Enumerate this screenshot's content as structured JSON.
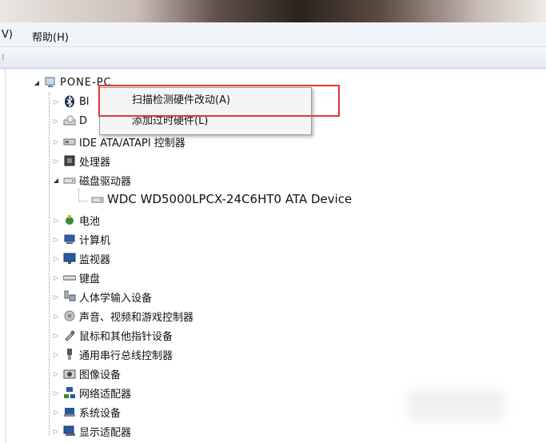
{
  "menubar": {
    "view_partial": "V)",
    "help": "帮助(H)"
  },
  "toolbar": {
    "partial_icon": "⁝"
  },
  "tree": {
    "root": "PONE-PC",
    "bluetooth_partial": "Bl",
    "disk_partial": "D",
    "items": [
      {
        "label": "IDE ATA/ATAPI 控制器"
      },
      {
        "label": "处理器"
      },
      {
        "label": "磁盘驱动器"
      },
      {
        "label": "WDC WD5000LPCX-24C6HT0 ATA Device"
      },
      {
        "label": "电池"
      },
      {
        "label": "计算机"
      },
      {
        "label": "监视器"
      },
      {
        "label": "键盘"
      },
      {
        "label": "人体学输入设备"
      },
      {
        "label": "声音、视频和游戏控制器"
      },
      {
        "label": "鼠标和其他指针设备"
      },
      {
        "label": "通用串行总线控制器"
      },
      {
        "label": "图像设备"
      },
      {
        "label": "网络适配器"
      },
      {
        "label": "系统设备"
      },
      {
        "label": "显示适配器"
      }
    ]
  },
  "context_menu": {
    "scan": "扫描检测硬件改动(A)",
    "add_legacy": "添加过时硬件(L)"
  },
  "colors": {
    "highlight_box": "#e03838",
    "menu_bg": "#f5f5f5"
  }
}
